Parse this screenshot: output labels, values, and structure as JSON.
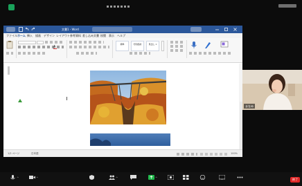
{
  "word": {
    "title": "文書1 - Word",
    "menu": [
      "ファイル",
      "ホーム",
      "挿入",
      "描画",
      "デザイン",
      "レイアウト",
      "参考資料",
      "差し込み文書",
      "校閲",
      "表示",
      "ヘルプ"
    ],
    "active_menu_index": 1,
    "styles": [
      "標準",
      "行間詰め",
      "見出し 1"
    ],
    "status_left": "1/2 ページ",
    "status_mid": "日本語",
    "status_right": "100%"
  },
  "participant": {
    "name": "まなみ"
  },
  "controls": {
    "end_label": "終了"
  },
  "colors": {
    "word_blue": "#2b579a",
    "end_red": "#e02828",
    "security_green": "#19a25a"
  }
}
